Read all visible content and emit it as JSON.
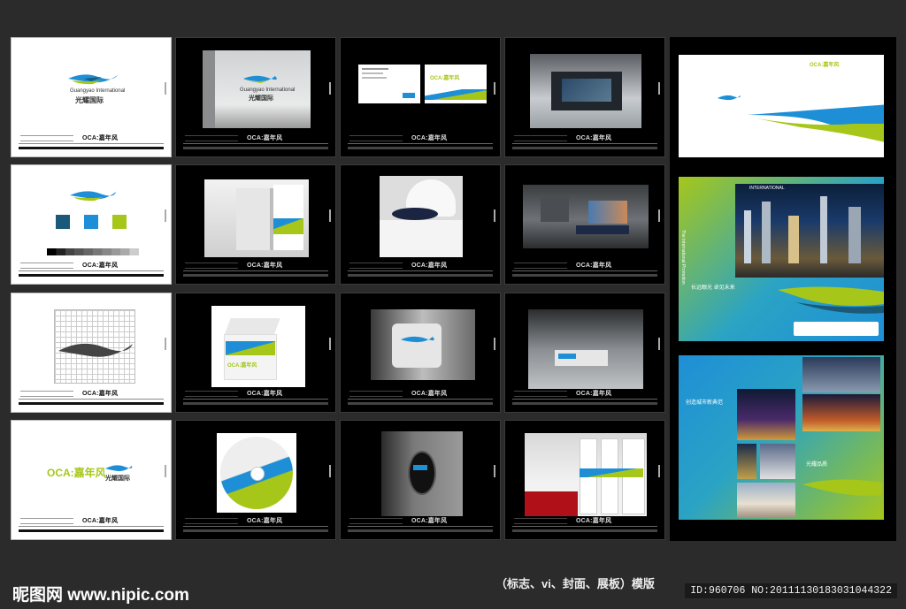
{
  "watermark": {
    "site_cn": "昵图网",
    "site_url": "www.nipic.com"
  },
  "caption": "（标志、vi、封面、展板）模版",
  "image_id": "ID:960706 NO:20111130183031044322",
  "brand": {
    "oca": "OCA",
    "oca_cn": "嘉年风",
    "name_en": "Guangyao International",
    "name_cn": "光耀国际"
  },
  "colors": {
    "teal_dark": "#1a5a78",
    "blue": "#1e8fd6",
    "lime": "#a6c71a",
    "bg": "#2b2b2b"
  },
  "brochure": {
    "headline": "INTERNATIONAL",
    "text1": "长远眼光 卓见未来",
    "text2": "创造城市新典范",
    "text3": "光耀品质",
    "vertical": "The International Promotion"
  }
}
